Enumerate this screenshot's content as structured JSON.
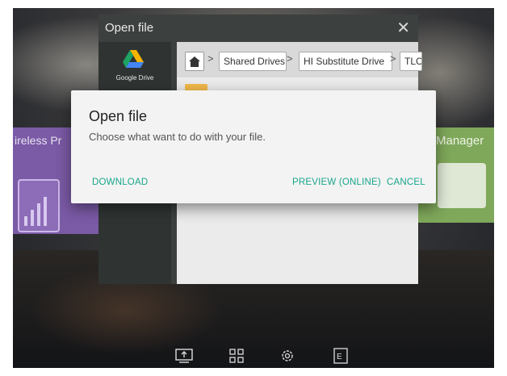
{
  "background_tiles": {
    "left_title": "ireless Pr",
    "right_title": "Manager"
  },
  "bg_window": {
    "title": "Open file",
    "close_icon": "close-icon",
    "rail_item_label": "Google Drive",
    "breadcrumb": [
      "Shared Drives",
      "HI Substitute Drive",
      "TLC"
    ]
  },
  "dialog": {
    "title": "Open file",
    "message": "Choose what want to do with your file.",
    "download_label": "DOWNLOAD",
    "preview_label": "PREVIEW (ONLINE)",
    "cancel_label": "CANCEL",
    "accent_color": "#18a58b"
  },
  "taskbar": {
    "icons": [
      "screen-share-icon",
      "apps-grid-icon",
      "settings-gear-icon",
      "annotate-icon"
    ]
  }
}
